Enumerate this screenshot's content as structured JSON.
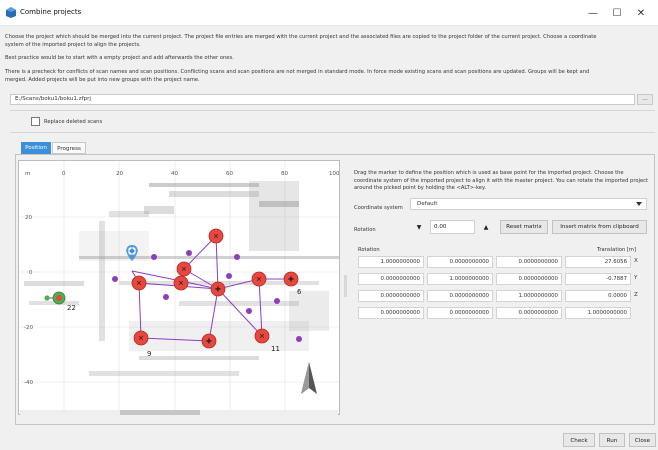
{
  "window": {
    "title": "Combine projects",
    "minimize_glyph": "—",
    "maximize_glyph": "☐",
    "close_glyph": "✕",
    "app_icon": "app-icon"
  },
  "intro": {
    "line1": "Choose the project which should be merged into the current project. The project file entries are merged with the current project and the associated files are copied to the project folder of the current project. Choose a coordinate",
    "line2": "system of the imported project to align the projects.",
    "line3": "Best practice would be to start with a empty project and add afterwards the other ones.",
    "line4": "There is a precheck for conflicts of scan names and scan positions. Conflicting scans and scan positions are not merged in standard mode. In force mode existing scans and scan positions are updated. Groups will be kept and",
    "line5": "merged. Added projects will be put into new groups with the project name."
  },
  "path": {
    "value": "E:/Scans/boku1/boku1.zfprj",
    "browse_label": "..."
  },
  "replace_deleted": {
    "label": "Replace deleted scans",
    "checked": false
  },
  "tabs": [
    {
      "label": "Position",
      "active": true
    },
    {
      "label": "Progress",
      "active": false
    }
  ],
  "map": {
    "x_ticks": [
      "m",
      "0",
      "20",
      "40",
      "60",
      "80",
      "100"
    ],
    "y_ticks": [
      "20",
      "0",
      "-20",
      "-40"
    ],
    "labels": [
      "22",
      "9",
      "11",
      "6"
    ]
  },
  "position_panel": {
    "instructions": "Drag the marker to define the position which is used as base point for the imported project. Choose the coordinate system of the imported project to align it with the master project. You can rotate the imported project around the picked point by holding the <ALT>-key.",
    "coordinate_system_label": "Coordinate system",
    "coordinate_system_value": "Default",
    "rotation_label": "Rotation",
    "rotation_value": "0.00",
    "reset_matrix_label": "Reset matrix",
    "insert_matrix_label": "Insert matrix from clipboard",
    "matrix_rotation_header": "Rotation",
    "matrix_translation_header": "Translation [m]",
    "matrix_rows": [
      {
        "r1": "1.0000000000",
        "r2": "0.0000000000",
        "r3": "0.0000000000",
        "t": "27.6056",
        "axis": "X"
      },
      {
        "r1": "0.0000000000",
        "r2": "1.0000000000",
        "r3": "0.0000000000",
        "t": "-0.7887",
        "axis": "Y"
      },
      {
        "r1": "0.0000000000",
        "r2": "0.0000000000",
        "r3": "1.0000000000",
        "t": "0.0000",
        "axis": "Z"
      },
      {
        "r1": "0.0000000000",
        "r2": "0.0000000000",
        "r3": "0.0000000000",
        "t": "1.0000000000",
        "axis": ""
      }
    ]
  },
  "footer": {
    "check_label": "Check",
    "run_label": "Run",
    "close_label": "Close"
  },
  "colors": {
    "accent": "#3a8fd8",
    "scan_marker": "#e8473f",
    "link": "#8b3fbf",
    "picked_point": "#3a8fd8",
    "green_marker": "#4caf50"
  }
}
